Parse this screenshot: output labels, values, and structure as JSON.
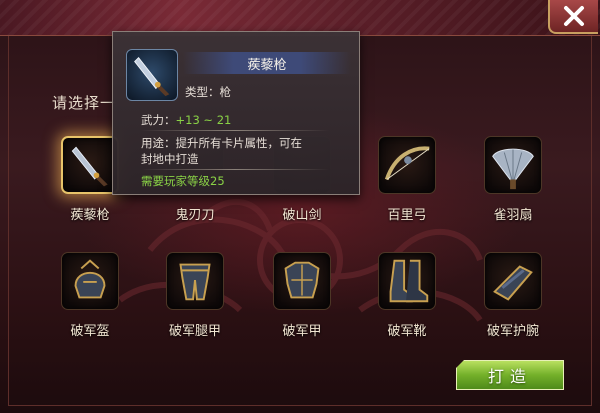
{
  "prompt": "请选择一",
  "items": [
    {
      "label": "蒺藜枪",
      "icon": "spear-icon",
      "selected": true
    },
    {
      "label": "鬼刃刀",
      "icon": "blade-icon",
      "selected": false
    },
    {
      "label": "破山剑",
      "icon": "sword-icon",
      "selected": false
    },
    {
      "label": "百里弓",
      "icon": "bow-icon",
      "selected": false
    },
    {
      "label": "雀羽扇",
      "icon": "feather-fan-icon",
      "selected": false
    },
    {
      "label": "破军盔",
      "icon": "helmet-icon",
      "selected": false
    },
    {
      "label": "破军腿甲",
      "icon": "leg-armor-icon",
      "selected": false
    },
    {
      "label": "破军甲",
      "icon": "chest-armor-icon",
      "selected": false
    },
    {
      "label": "破军靴",
      "icon": "boots-icon",
      "selected": false
    },
    {
      "label": "破军护腕",
      "icon": "bracer-icon",
      "selected": false
    }
  ],
  "tooltip": {
    "name": "蒺藜枪",
    "type_label": "类型：枪",
    "stat_label": "武力：",
    "stat_value": "+13 ~ 21",
    "usage_line1": "用途：提升所有卡片属性，可在",
    "usage_line2": "封地中打造",
    "requirement": "需要玩家等级25"
  },
  "craft_button": "打造",
  "colors": {
    "background": "#2a1216",
    "selected_glow": "#e8c46a",
    "stat_green": "#8ad246",
    "craft_green": "#74b02a"
  }
}
